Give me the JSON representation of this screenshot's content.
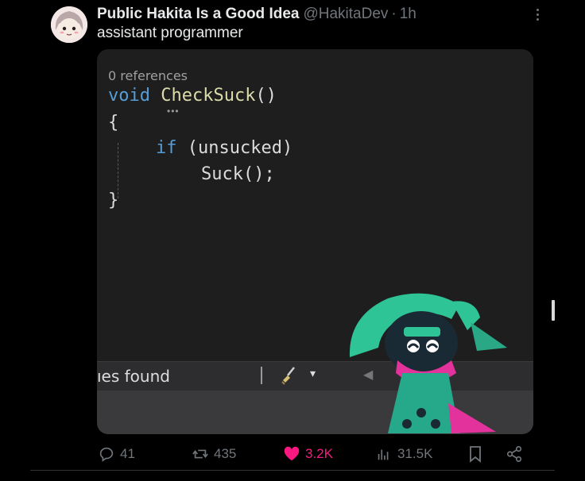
{
  "tweet": {
    "display_name": "Public Hakita Is a Good Idea",
    "handle": "@HakitaDev",
    "separator": "·",
    "time": "1h",
    "text": "assistant programmer"
  },
  "code": {
    "references": "0 references",
    "line1_keyword": "void",
    "line1_name": "CheckSuck",
    "line1_parens": "()",
    "open_brace": "{",
    "line3_keyword": "if",
    "line3_rest": " (unsucked)",
    "line4": "Suck();",
    "close_brace": "}"
  },
  "status_bar": {
    "text": "ıes found",
    "dropdown_caret": "▾",
    "left_arrow": "◀"
  },
  "actions": {
    "replies": "41",
    "reposts": "435",
    "likes": "3.2K",
    "views": "31.5K"
  },
  "icons": {
    "more": "more-icon",
    "reply": "reply-icon",
    "repost": "repost-icon",
    "like": "heart-icon",
    "views": "views-icon",
    "bookmark": "bookmark-icon",
    "share": "share-icon"
  },
  "colors": {
    "like_active": "#f91880",
    "muted": "#71767b",
    "code_keyword": "#569cd6",
    "code_function": "#dcdcaa"
  }
}
